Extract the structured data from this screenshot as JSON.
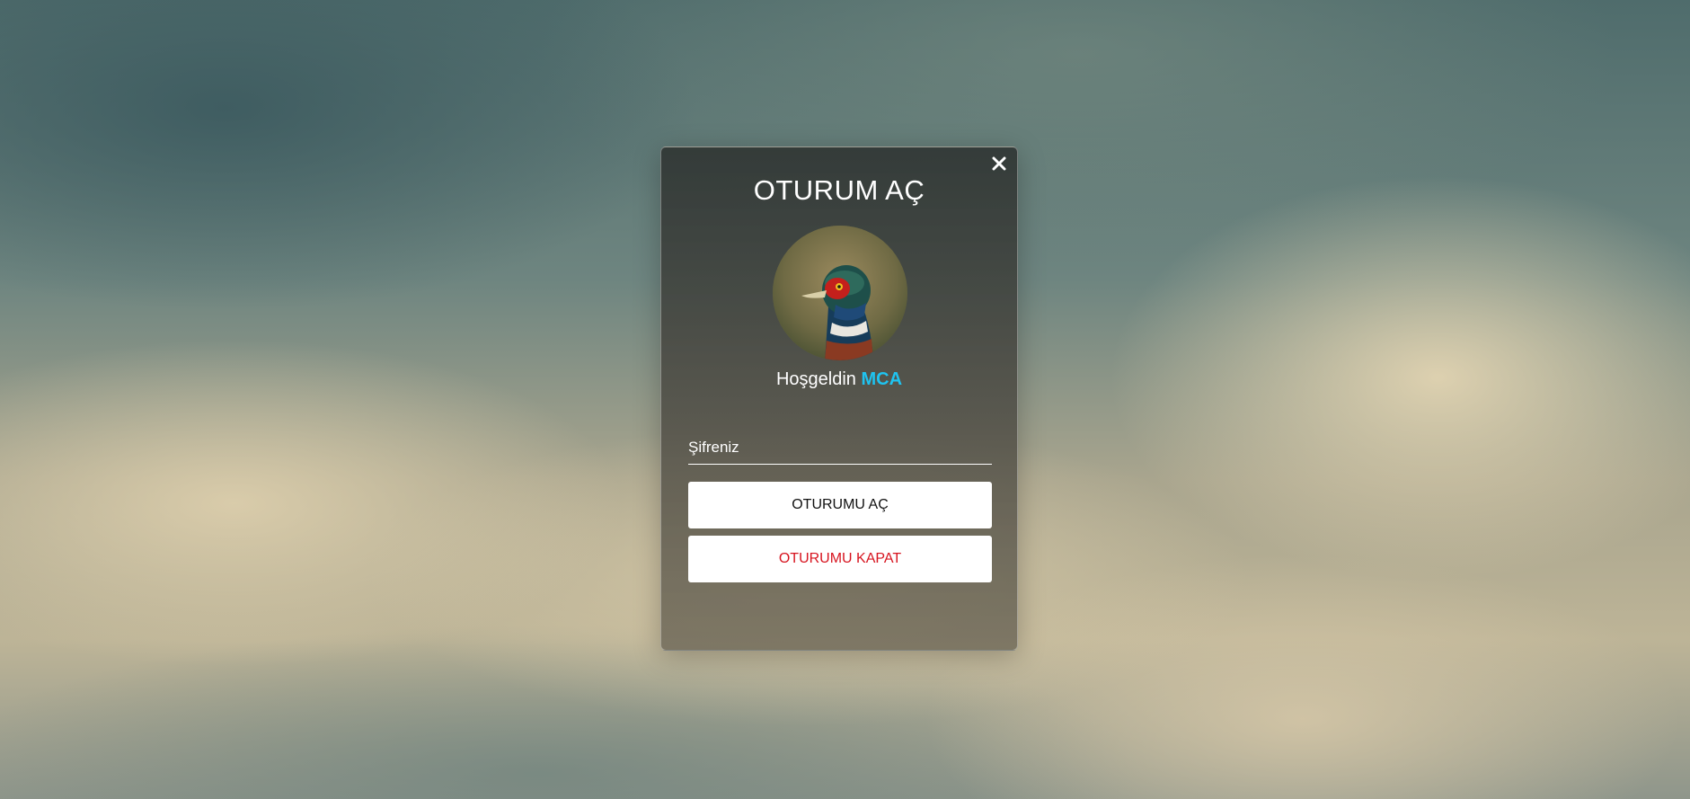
{
  "modal": {
    "title": "OTURUM AÇ",
    "close_icon": "close-icon",
    "avatar_icon": "bird-avatar",
    "welcome_prefix": "Hoşgeldin",
    "username": "MCA",
    "password_placeholder": "Şifreniz",
    "login_button": "OTURUMU AÇ",
    "logout_button": "OTURUMU KAPAT"
  },
  "colors": {
    "username": "#1fc3f0",
    "logout_text": "#d7141f",
    "button_bg": "#ffffff"
  }
}
